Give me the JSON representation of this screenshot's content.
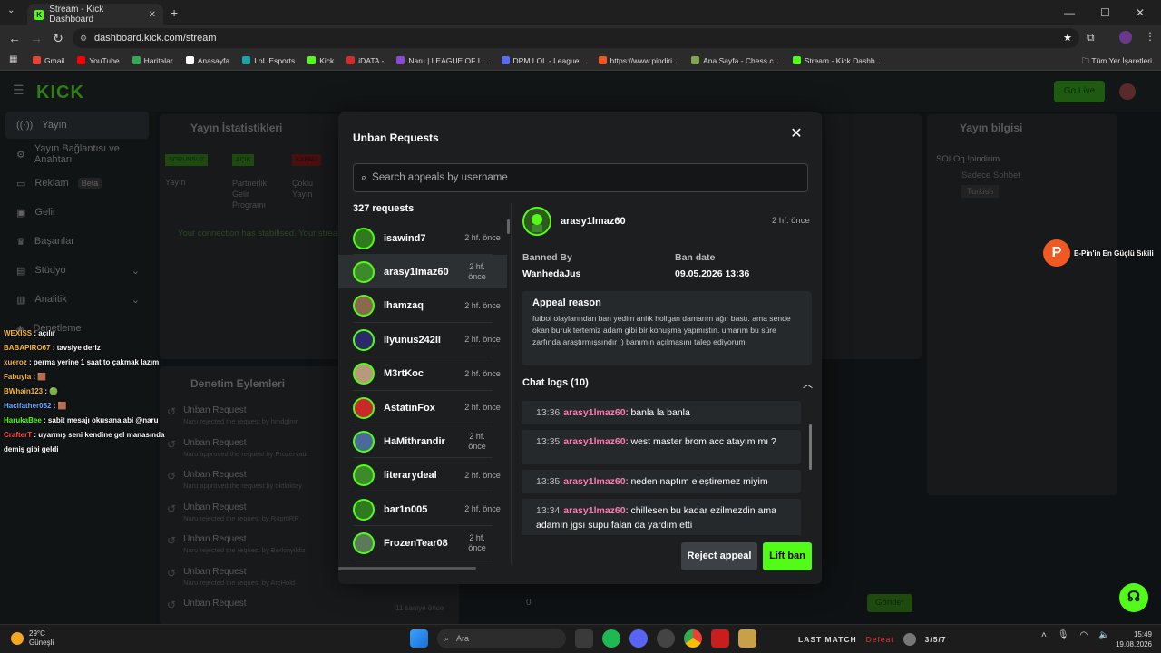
{
  "browser": {
    "tab_title": "Stream - Kick Dashboard",
    "new_tab": "+",
    "window_controls": [
      "—",
      "☐",
      "✕"
    ],
    "url": "dashboard.kick.com/stream",
    "bookmarks": [
      {
        "label": "Gmail",
        "color": "#ea4335"
      },
      {
        "label": "YouTube",
        "color": "#ff0000"
      },
      {
        "label": "Haritalar",
        "color": "#34a853"
      },
      {
        "label": "Anasayfa",
        "color": "#ffffff"
      },
      {
        "label": "LoL Esports",
        "color": "#1fa3a3"
      },
      {
        "label": "Kick",
        "color": "#53fc18"
      },
      {
        "label": "iDATA -",
        "color": "#d42a2a"
      },
      {
        "label": "Naru | LEAGUE OF L...",
        "color": "#8a4ad6"
      },
      {
        "label": "DPM.LOL - League...",
        "color": "#5b6cf0"
      },
      {
        "label": "https://www.pindiri...",
        "color": "#f05a22"
      },
      {
        "label": "Ana Sayfa - Chess.c...",
        "color": "#7fa650"
      },
      {
        "label": "Stream - Kick Dashb...",
        "color": "#53fc18"
      }
    ],
    "all_bookmarks": "Tüm Yer İşaretleri"
  },
  "kick": {
    "logo": "KICK",
    "go_live": "Go Live",
    "sidebar": [
      "Yayın",
      "Yayın Bağlantısı ve Anahtarı",
      "Reklam",
      "Gelir",
      "Başarılar",
      "Stüdyo",
      "Analitik",
      "Denetleme"
    ],
    "beta": "Beta",
    "stats_title": "Yayın İstatistikleri",
    "stat_badges": [
      "SORUNSUZ",
      "AÇIK",
      "KAPALI"
    ],
    "stat_labels": [
      "Yayın",
      "Partnerlik Gelir Programı",
      "Çoklu Yayın"
    ],
    "connection": "Your connection has stabilised. Your stream...",
    "mod_title": "Denetim Eylemleri",
    "mod_actions": [
      {
        "title": "Unban Request",
        "sub": "Naru rejected the request by hmdglmr"
      },
      {
        "title": "Unban Request",
        "sub": "Naru approved the request by Prozervatif"
      },
      {
        "title": "Unban Request",
        "sub": "Naru approved the request by oktloktay"
      },
      {
        "title": "Unban Request",
        "sub": "Naru rejected the request by R4pt0RR"
      },
      {
        "title": "Unban Request",
        "sub": "Naru rejected the request by Berkinyildiz"
      },
      {
        "title": "Unban Request",
        "sub": "Naru rejected the request by ArcHold"
      },
      {
        "title": "Unban Request",
        "sub": ""
      }
    ],
    "mod_time": "11 saniye önce",
    "info_title": "Yayın bilgisi",
    "stream_title": "SOLOq !pindirim",
    "category": "Sadece Sohbet",
    "language": "Turkish",
    "send": "Gönder",
    "viewers": "0"
  },
  "chat_overlay": [
    {
      "user": "WEXISS",
      "color": "#f5b942",
      "msg": "açılır"
    },
    {
      "user": "BABAPIRO67",
      "color": "#f5b942",
      "msg": "tavsiye deriz"
    },
    {
      "user": "xueroz",
      "color": "#f5b942",
      "msg": "perma yerine 1 saat to çakmak lazım"
    },
    {
      "user": "Fabuyla",
      "color": "#f5b942",
      "msg": "🟫"
    },
    {
      "user": "BWhain123",
      "color": "#f5b942",
      "msg": "🟢"
    },
    {
      "user": "Hacifather082",
      "color": "#6fa8ff",
      "msg": "🟫"
    },
    {
      "user": "HarukaBee",
      "color": "#53fc18",
      "msg": "sabit mesajı okusana abi @naru"
    },
    {
      "user": "CrafterT",
      "color": "#ff4d4d",
      "msg": "uyarmış seni kendine gel manasında demiş gibi geldi"
    }
  ],
  "modal": {
    "title": "Unban Requests",
    "search_placeholder": "Search appeals by username",
    "count": "327 requests",
    "requests": [
      {
        "name": "isawind7",
        "time": "2 hf. önce",
        "color": "#2f7a1f"
      },
      {
        "name": "arasy1lmaz60",
        "time": "2 hf. önce",
        "color": "#3d8a2a"
      },
      {
        "name": "lhamzaq",
        "time": "2 hf. önce",
        "color": "#8a6a4a"
      },
      {
        "name": "Ilyunus242Il",
        "time": "2 hf. önce",
        "color": "#2a2a6a"
      },
      {
        "name": "M3rtKoc",
        "time": "2 hf. önce",
        "color": "#b89a7a"
      },
      {
        "name": "AstatinFox",
        "time": "2 hf. önce",
        "color": "#c82a2a"
      },
      {
        "name": "HaMithrandir",
        "time": "2 hf. önce",
        "color": "#4a6a9a"
      },
      {
        "name": "literarydeal",
        "time": "2 hf. önce",
        "color": "#3d8a2a"
      },
      {
        "name": "bar1n005",
        "time": "2 hf. önce",
        "color": "#2f7a1f"
      },
      {
        "name": "FrozenTear08",
        "time": "2 hf. önce",
        "color": "#5a7a5a"
      }
    ],
    "detail": {
      "name": "arasy1lmaz60",
      "time": "2 hf. önce",
      "banned_by_label": "Banned By",
      "banned_by": "WanhedaJus",
      "ban_date_label": "Ban date",
      "ban_date": "09.05.2026 13:36",
      "reason_label": "Appeal reason",
      "reason": "futbol olaylarından ban yedim anlık holigan damarım ağır bastı. ama sende okan buruk tertemiz adam gibi bir konuşma yapmıştın. umarım bu süre zarfında araştırmışsındır :) banımın açılmasını talep ediyorum.",
      "chat_logs_label": "Chat logs (10)",
      "chat_logs": [
        {
          "time": "13:36",
          "user": "arasy1lmaz60",
          "msg": "banla la banla"
        },
        {
          "time": "13:35",
          "user": "arasy1lmaz60",
          "msg": "west master brom acc atayım mı ?"
        },
        {
          "time": "13:35",
          "user": "arasy1lmaz60",
          "msg": "neden naptım eleştiremez miyim"
        },
        {
          "time": "13:34",
          "user": "arasy1lmaz60",
          "msg": "chillesen bu kadar ezilmezdin ama adamın jgsı supu falan da yardım etti"
        }
      ],
      "reject": "Reject appeal",
      "lift": "Lift ban"
    }
  },
  "promo": {
    "logo": "P",
    "text": "E-Pin'in En Güçlü Sıkili"
  },
  "taskbar": {
    "temp": "29°C",
    "weather": "Güneşli",
    "search": "Ara",
    "last_match": "LAST MATCH",
    "result": "Defeat",
    "kda": "3/5/7",
    "time": "15:49",
    "date": "19.08.2026"
  }
}
